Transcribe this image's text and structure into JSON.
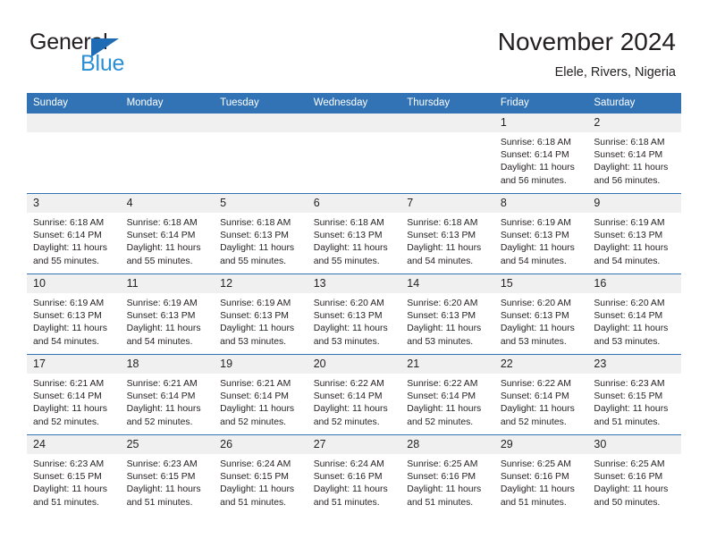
{
  "brand": {
    "name_top": "General",
    "name_bottom": "Blue",
    "triangle_color": "#1f6cb4",
    "blue_color": "#2a8fd4"
  },
  "header": {
    "title": "November 2024",
    "subtitle": "Elele, Rivers, Nigeria",
    "accent_color": "#3273b5"
  },
  "calendar": {
    "weekday_headers": [
      "Sunday",
      "Monday",
      "Tuesday",
      "Wednesday",
      "Thursday",
      "Friday",
      "Saturday"
    ],
    "labels": {
      "sunrise": "Sunrise:",
      "sunset": "Sunset:",
      "daylight": "Daylight:"
    },
    "weeks": [
      [
        {
          "day": "",
          "empty": true
        },
        {
          "day": "",
          "empty": true
        },
        {
          "day": "",
          "empty": true
        },
        {
          "day": "",
          "empty": true
        },
        {
          "day": "",
          "empty": true
        },
        {
          "day": "1",
          "sunrise": "Sunrise: 6:18 AM",
          "sunset": "Sunset: 6:14 PM",
          "daylight1": "Daylight: 11 hours",
          "daylight2": "and 56 minutes."
        },
        {
          "day": "2",
          "sunrise": "Sunrise: 6:18 AM",
          "sunset": "Sunset: 6:14 PM",
          "daylight1": "Daylight: 11 hours",
          "daylight2": "and 56 minutes."
        }
      ],
      [
        {
          "day": "3",
          "sunrise": "Sunrise: 6:18 AM",
          "sunset": "Sunset: 6:14 PM",
          "daylight1": "Daylight: 11 hours",
          "daylight2": "and 55 minutes."
        },
        {
          "day": "4",
          "sunrise": "Sunrise: 6:18 AM",
          "sunset": "Sunset: 6:14 PM",
          "daylight1": "Daylight: 11 hours",
          "daylight2": "and 55 minutes."
        },
        {
          "day": "5",
          "sunrise": "Sunrise: 6:18 AM",
          "sunset": "Sunset: 6:13 PM",
          "daylight1": "Daylight: 11 hours",
          "daylight2": "and 55 minutes."
        },
        {
          "day": "6",
          "sunrise": "Sunrise: 6:18 AM",
          "sunset": "Sunset: 6:13 PM",
          "daylight1": "Daylight: 11 hours",
          "daylight2": "and 55 minutes."
        },
        {
          "day": "7",
          "sunrise": "Sunrise: 6:18 AM",
          "sunset": "Sunset: 6:13 PM",
          "daylight1": "Daylight: 11 hours",
          "daylight2": "and 54 minutes."
        },
        {
          "day": "8",
          "sunrise": "Sunrise: 6:19 AM",
          "sunset": "Sunset: 6:13 PM",
          "daylight1": "Daylight: 11 hours",
          "daylight2": "and 54 minutes."
        },
        {
          "day": "9",
          "sunrise": "Sunrise: 6:19 AM",
          "sunset": "Sunset: 6:13 PM",
          "daylight1": "Daylight: 11 hours",
          "daylight2": "and 54 minutes."
        }
      ],
      [
        {
          "day": "10",
          "sunrise": "Sunrise: 6:19 AM",
          "sunset": "Sunset: 6:13 PM",
          "daylight1": "Daylight: 11 hours",
          "daylight2": "and 54 minutes."
        },
        {
          "day": "11",
          "sunrise": "Sunrise: 6:19 AM",
          "sunset": "Sunset: 6:13 PM",
          "daylight1": "Daylight: 11 hours",
          "daylight2": "and 54 minutes."
        },
        {
          "day": "12",
          "sunrise": "Sunrise: 6:19 AM",
          "sunset": "Sunset: 6:13 PM",
          "daylight1": "Daylight: 11 hours",
          "daylight2": "and 53 minutes."
        },
        {
          "day": "13",
          "sunrise": "Sunrise: 6:20 AM",
          "sunset": "Sunset: 6:13 PM",
          "daylight1": "Daylight: 11 hours",
          "daylight2": "and 53 minutes."
        },
        {
          "day": "14",
          "sunrise": "Sunrise: 6:20 AM",
          "sunset": "Sunset: 6:13 PM",
          "daylight1": "Daylight: 11 hours",
          "daylight2": "and 53 minutes."
        },
        {
          "day": "15",
          "sunrise": "Sunrise: 6:20 AM",
          "sunset": "Sunset: 6:13 PM",
          "daylight1": "Daylight: 11 hours",
          "daylight2": "and 53 minutes."
        },
        {
          "day": "16",
          "sunrise": "Sunrise: 6:20 AM",
          "sunset": "Sunset: 6:14 PM",
          "daylight1": "Daylight: 11 hours",
          "daylight2": "and 53 minutes."
        }
      ],
      [
        {
          "day": "17",
          "sunrise": "Sunrise: 6:21 AM",
          "sunset": "Sunset: 6:14 PM",
          "daylight1": "Daylight: 11 hours",
          "daylight2": "and 52 minutes."
        },
        {
          "day": "18",
          "sunrise": "Sunrise: 6:21 AM",
          "sunset": "Sunset: 6:14 PM",
          "daylight1": "Daylight: 11 hours",
          "daylight2": "and 52 minutes."
        },
        {
          "day": "19",
          "sunrise": "Sunrise: 6:21 AM",
          "sunset": "Sunset: 6:14 PM",
          "daylight1": "Daylight: 11 hours",
          "daylight2": "and 52 minutes."
        },
        {
          "day": "20",
          "sunrise": "Sunrise: 6:22 AM",
          "sunset": "Sunset: 6:14 PM",
          "daylight1": "Daylight: 11 hours",
          "daylight2": "and 52 minutes."
        },
        {
          "day": "21",
          "sunrise": "Sunrise: 6:22 AM",
          "sunset": "Sunset: 6:14 PM",
          "daylight1": "Daylight: 11 hours",
          "daylight2": "and 52 minutes."
        },
        {
          "day": "22",
          "sunrise": "Sunrise: 6:22 AM",
          "sunset": "Sunset: 6:14 PM",
          "daylight1": "Daylight: 11 hours",
          "daylight2": "and 52 minutes."
        },
        {
          "day": "23",
          "sunrise": "Sunrise: 6:23 AM",
          "sunset": "Sunset: 6:15 PM",
          "daylight1": "Daylight: 11 hours",
          "daylight2": "and 51 minutes."
        }
      ],
      [
        {
          "day": "24",
          "sunrise": "Sunrise: 6:23 AM",
          "sunset": "Sunset: 6:15 PM",
          "daylight1": "Daylight: 11 hours",
          "daylight2": "and 51 minutes."
        },
        {
          "day": "25",
          "sunrise": "Sunrise: 6:23 AM",
          "sunset": "Sunset: 6:15 PM",
          "daylight1": "Daylight: 11 hours",
          "daylight2": "and 51 minutes."
        },
        {
          "day": "26",
          "sunrise": "Sunrise: 6:24 AM",
          "sunset": "Sunset: 6:15 PM",
          "daylight1": "Daylight: 11 hours",
          "daylight2": "and 51 minutes."
        },
        {
          "day": "27",
          "sunrise": "Sunrise: 6:24 AM",
          "sunset": "Sunset: 6:16 PM",
          "daylight1": "Daylight: 11 hours",
          "daylight2": "and 51 minutes."
        },
        {
          "day": "28",
          "sunrise": "Sunrise: 6:25 AM",
          "sunset": "Sunset: 6:16 PM",
          "daylight1": "Daylight: 11 hours",
          "daylight2": "and 51 minutes."
        },
        {
          "day": "29",
          "sunrise": "Sunrise: 6:25 AM",
          "sunset": "Sunset: 6:16 PM",
          "daylight1": "Daylight: 11 hours",
          "daylight2": "and 51 minutes."
        },
        {
          "day": "30",
          "sunrise": "Sunrise: 6:25 AM",
          "sunset": "Sunset: 6:16 PM",
          "daylight1": "Daylight: 11 hours",
          "daylight2": "and 50 minutes."
        }
      ]
    ]
  }
}
